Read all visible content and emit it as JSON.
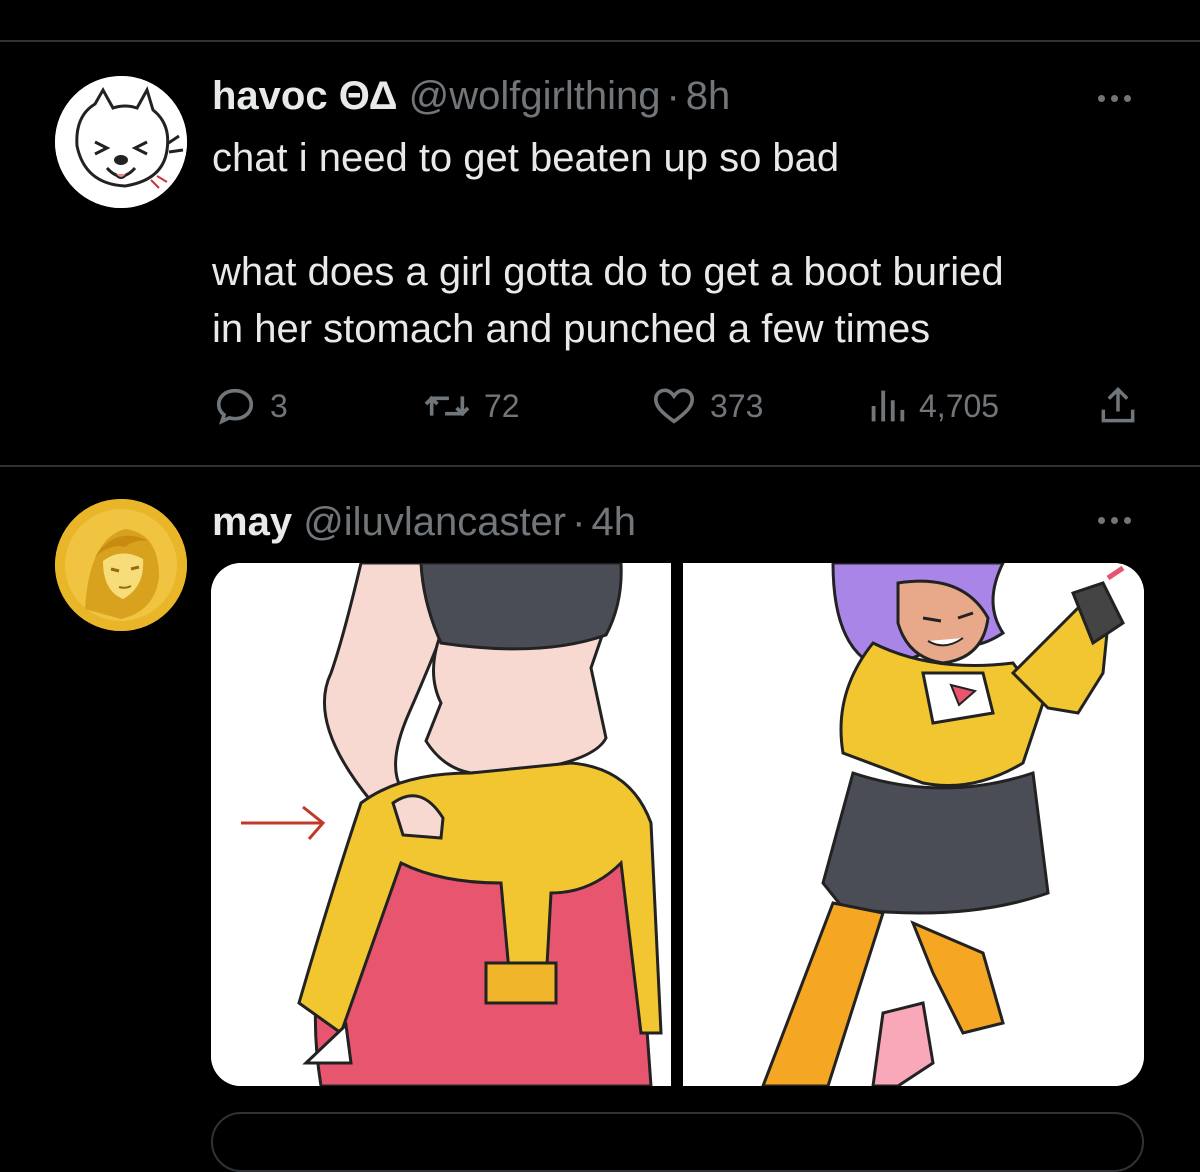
{
  "tweets": [
    {
      "display_name": "havoc ΘΔ",
      "handle": "@wolfgirlthing",
      "separator": "·",
      "time": "8h",
      "text_line1": "chat i need to get beaten up so bad",
      "text_line2": "what does a girl gotta do to get a boot buried",
      "text_line3": "in her stomach and punched a few times",
      "stats": {
        "replies": "3",
        "retweets": "72",
        "likes": "373",
        "views": "4,705"
      }
    },
    {
      "display_name": "may",
      "handle": "@iluvlancaster",
      "separator": "·",
      "time": "4h"
    }
  ],
  "colors": {
    "background": "#000000",
    "text": "#e7e9ea",
    "secondary": "#71767b",
    "divider": "#2f3336"
  },
  "icons": [
    "reply-icon",
    "retweet-icon",
    "like-icon",
    "views-icon",
    "share-icon",
    "more-icon"
  ]
}
